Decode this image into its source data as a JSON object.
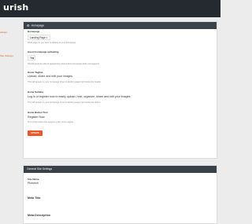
{
  "app": {
    "logo": "urish"
  },
  "sidebar": {
    "items": [
      {
        "label": "ettings"
      },
      {
        "label": "Site Settings"
      }
    ]
  },
  "homepage_panel": {
    "header": "Homepage",
    "homepage_label": "Homepage",
    "homepage_select": "Landing Page",
    "homepage_help": "What page do you want to display as your homepage",
    "guest_label": "Guest homepage uploading",
    "guest_select": "Yes",
    "guest_help": "Should users be able to upload their photos from homepage while not logged in",
    "tagline_label": "Home Tagline",
    "tagline_value": "Upload, share and edit your images.",
    "tagline_help": "This will appear on your homepage (if set to landing page) right below the header.",
    "subline_label": "Home Subline",
    "subline_value": "Log in or register now to easily upload, host, organize, share and edit your images.",
    "subline_help": "This will appear on your homepage (if set to landing page) right below the tagline.",
    "button_label": "Home Button Text",
    "button_value": "Register Now",
    "button_help": "Text of the button that appears under home tagline.",
    "update_button": "UPDATE"
  },
  "general_panel": {
    "header": "General Site Settings",
    "site_name_label": "Site Name",
    "site_name_value": "Picturish",
    "meta_title_label": "Meta Title",
    "meta_desc_label": "Meta Description"
  },
  "colors": {
    "accent": "#e8582b",
    "header": "#3a4149",
    "topbar": "#252a30"
  }
}
